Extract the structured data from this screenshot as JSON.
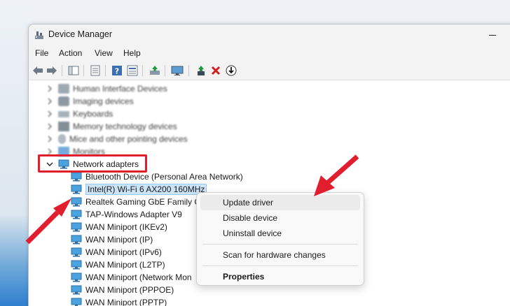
{
  "window": {
    "title": "Device Manager"
  },
  "menu": [
    "File",
    "Action",
    "View",
    "Help"
  ],
  "toolbar": {
    "icons": [
      "back-arrow-icon",
      "forward-arrow-icon",
      "properties-sheet-icon",
      "console-tree-icon",
      "help-icon",
      "view-list-icon",
      "scan-hardware-icon",
      "monitor-icon",
      "update-driver-icon",
      "uninstall-x-icon",
      "download-circle-icon"
    ],
    "colors": {
      "green": "#1a9a3c",
      "red": "#d31f1f"
    }
  },
  "tree": {
    "categories_above": [
      "Human Interface Devices",
      "Imaging devices",
      "Keyboards",
      "Memory technology devices",
      "Mice and other pointing devices",
      "Monitors"
    ],
    "expanded_category": "Network adapters",
    "children": [
      "Bluetooth Device (Personal Area Network)",
      "Intel(R) Wi-Fi 6 AX200 160MHz",
      "Realtek Gaming GbE Family C",
      "TAP-Windows Adapter V9",
      "WAN Miniport (IKEv2)",
      "WAN Miniport (IP)",
      "WAN Miniport (IPv6)",
      "WAN Miniport (L2TP)",
      "WAN Miniport (Network Mon",
      "WAN Miniport (PPPOE)",
      "WAN Miniport (PPTP)"
    ],
    "selected_child": "Intel(R) Wi-Fi 6 AX200 160MHz"
  },
  "context_menu": {
    "update_driver": "Update driver",
    "disable_device": "Disable device",
    "uninstall_device": "Uninstall device",
    "scan": "Scan for hardware changes",
    "properties": "Properties"
  },
  "annotation_color": "#e01e2d"
}
